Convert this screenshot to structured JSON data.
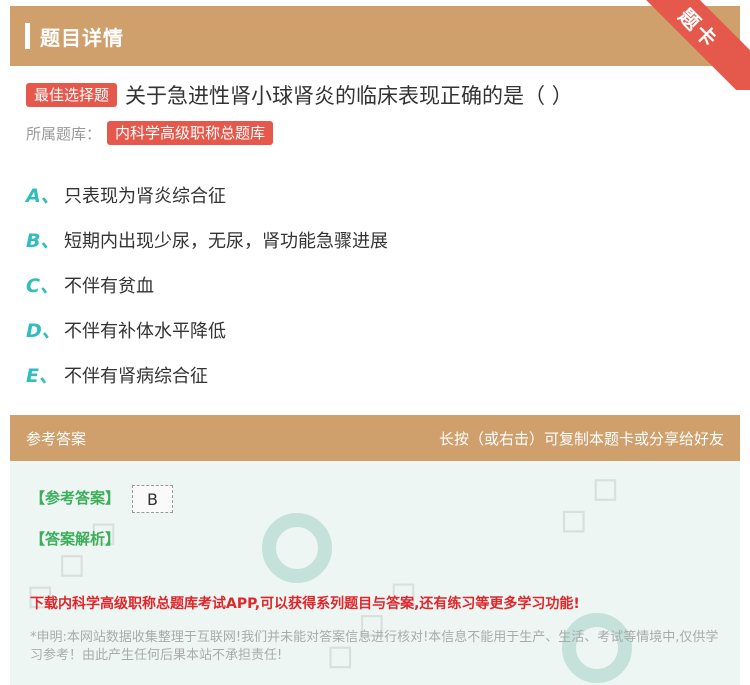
{
  "header": {
    "title": "题目详情",
    "corner_label": "题卡"
  },
  "question": {
    "type_tag": "最佳选择题",
    "text": "关于急进性肾小球肾炎的临床表现正确的是（ ）",
    "source_label": "所属题库：",
    "source_name": "内科学高级职称总题库"
  },
  "options": [
    {
      "letter": "A、",
      "text": "只表现为肾炎综合征"
    },
    {
      "letter": "B、",
      "text": "短期内出现少尿，无尿，肾功能急骤进展"
    },
    {
      "letter": "C、",
      "text": "不伴有贫血"
    },
    {
      "letter": "D、",
      "text": "不伴有补体水平降低"
    },
    {
      "letter": "E、",
      "text": "不伴有肾病综合征"
    }
  ],
  "answer_section": {
    "header_left": "参考答案",
    "header_right": "长按（或右击）可复制本题卡或分享给好友",
    "answer_label": "【参考答案】",
    "answer_value": "B",
    "explanation_label": "【答案解析】",
    "promo": "下载内科学高级职称总题库考试APP,可以获得系列题目与答案,还有练习等更多学习功能!",
    "disclaimer": "*申明:本网站数据收集整理于互联网!我们并未能对答案信息进行核对!本信息不能用于生产、生活、考试等情境中,仅供学习参考！由此产生任何后果本站不承担责任!"
  },
  "colors": {
    "header": "#cf9f6c",
    "tag": "#e5594c",
    "option_letter": "#2fbdbd",
    "answer_label": "#3cae5a",
    "promo": "#e0262a"
  }
}
